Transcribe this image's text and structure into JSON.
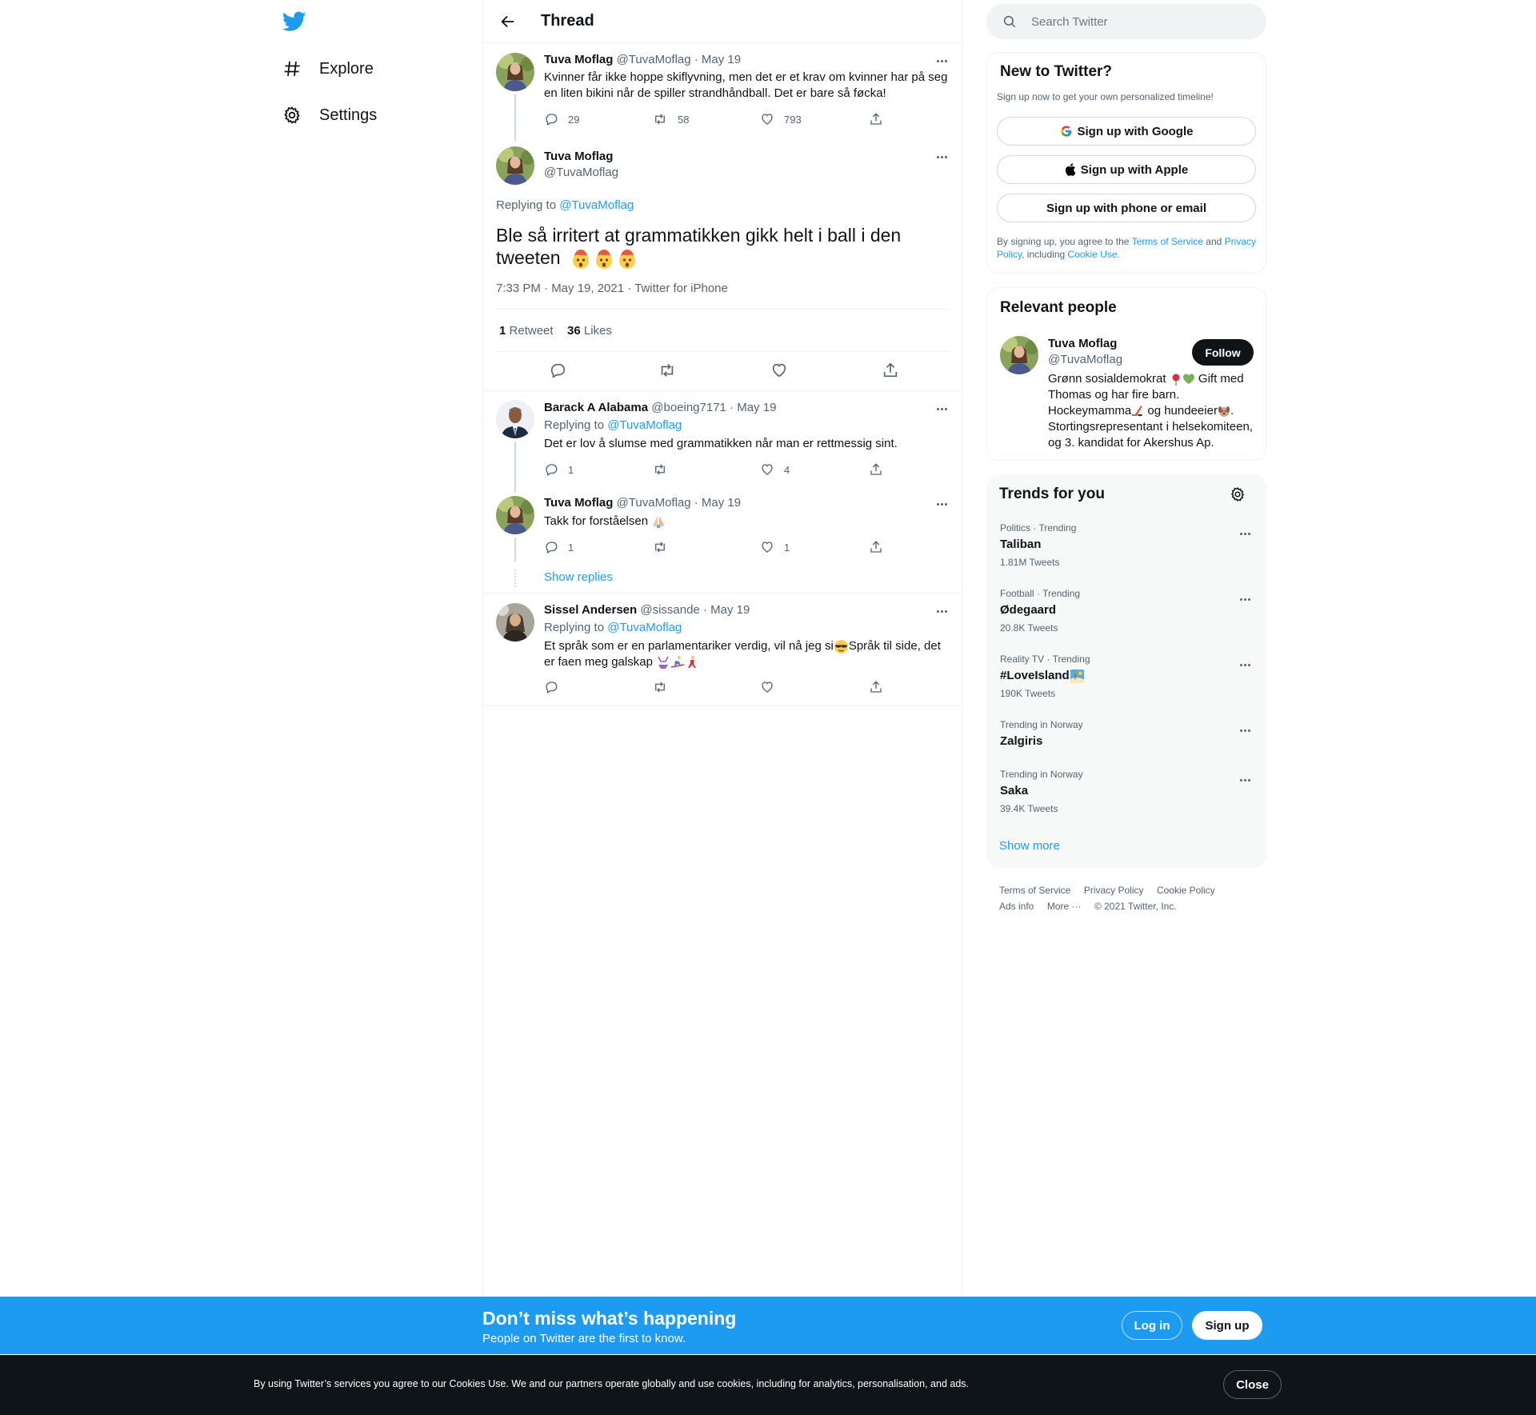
{
  "nav": {
    "explore_label": "Explore",
    "settings_label": "Settings"
  },
  "header": {
    "title": "Thread"
  },
  "tweets": {
    "first": {
      "name": "Tuva Moflag",
      "meta": "@TuvaMoflag · May 19",
      "text": "Kvinner får ikke hoppe skiflyvning, men det er et krav om kvinner har på seg en liten bikini når de spiller strandhåndball. Det er bare så føcka!",
      "replies": "29",
      "retweets": "58",
      "likes": "793"
    },
    "main": {
      "name": "Tuva Moflag",
      "handle": "@TuvaMoflag",
      "replying_prefix": "Replying to",
      "replying_handle": "@TuvaMoflag",
      "text": "Ble så irritert at grammatikken gikk helt i ball i den tweeten",
      "meta": "7:33 PM · May 19, 2021 · Twitter for iPhone",
      "retweet_count": "1",
      "retweet_label": "Retweet",
      "like_count": "36",
      "like_label": "Likes"
    },
    "reply1": {
      "name": "Barack A Alabama",
      "meta": "@boeing7171 · May 19",
      "replying_prefix": "Replying to",
      "replying_handle": "@TuvaMoflag",
      "text": "Det er lov å slumse med grammatikken når man er rettmessig sint.",
      "replies": "1",
      "likes": "4"
    },
    "reply2": {
      "name": "Tuva Moflag",
      "meta": "@TuvaMoflag · May 19",
      "text": "Takk for forståelsen",
      "replies": "1",
      "likes": "1",
      "show_replies": "Show replies"
    },
    "reply3": {
      "name": "Sissel Andersen",
      "meta": "@sissande · May 19",
      "replying_prefix": "Replying to",
      "replying_handle": "@TuvaMoflag",
      "text_part1": "Et språk som er en parlamentariker verdig, vil nå jeg si",
      "text_part2": "Språk til side, det er faen meg galskap"
    }
  },
  "search": {
    "placeholder": "Search Twitter"
  },
  "new_to_twitter": {
    "title": "New to Twitter?",
    "subtitle": "Sign up now to get your own personalized timeline!",
    "google": "Sign up with Google",
    "apple": "Sign up with Apple",
    "phone": "Sign up with phone or email",
    "legal_1": "By signing up, you agree to the",
    "terms": "Terms of Service",
    "and": "and",
    "privacy": "Privacy Policy",
    "including": ", including",
    "cookie": "Cookie Use."
  },
  "relevant": {
    "title": "Relevant people",
    "name": "Tuva Moflag",
    "handle": "@TuvaMoflag",
    "follow": "Follow",
    "bio_1": "Grønn sosialdemokrat",
    "bio_2": "Gift med",
    "bio_3": "Thomas og har fire barn.",
    "bio_4": "Hockeymamma",
    "bio_5": "og hundeeier",
    "bio_6": ".",
    "bio_7": "Stortingsrepresentant i helsekomiteen,",
    "bio_8": "og 3. kandidat for Akershus Ap."
  },
  "trends": {
    "title": "Trends for you",
    "items": [
      {
        "category": "Politics · Trending",
        "name": "Taliban",
        "count": "1.81M Tweets"
      },
      {
        "category": "Football · Trending",
        "name": "Ødegaard",
        "count": "20.8K Tweets"
      },
      {
        "category": "Reality TV · Trending",
        "name": "#LoveIsland",
        "count": "190K Tweets"
      },
      {
        "category": "Trending in Norway",
        "name": "Zalgiris",
        "count": ""
      },
      {
        "category": "Trending in Norway",
        "name": "Saka",
        "count": "39.4K Tweets"
      }
    ],
    "show_more": "Show more"
  },
  "footer": {
    "terms": "Terms of Service",
    "privacy": "Privacy Policy",
    "cookie": "Cookie Policy",
    "ads": "Ads info",
    "more": "More ···",
    "copyright": "© 2021 Twitter, Inc."
  },
  "bottom_bar": {
    "title": "Don’t miss what’s happening",
    "subtitle": "People on Twitter are the first to know.",
    "login": "Log in",
    "signup": "Sign up"
  },
  "cookie_bar": {
    "text": "By using Twitter’s services you agree to our Cookies Use. We and our partners operate globally and use cookies, including for analytics, personalisation, and ads.",
    "close": "Close"
  },
  "colors": {
    "accent": "#1d9bf0",
    "text": "#0f1419",
    "muted": "#536471",
    "border": "#eff3f4",
    "panel": "#f7f9f9"
  },
  "icons": [
    "twitter-logo-icon",
    "hashtag-icon",
    "gear-icon",
    "back-arrow-icon",
    "more-dots-icon",
    "reply-icon",
    "retweet-icon",
    "like-icon",
    "share-icon",
    "search-icon",
    "google-icon",
    "apple-icon"
  ]
}
